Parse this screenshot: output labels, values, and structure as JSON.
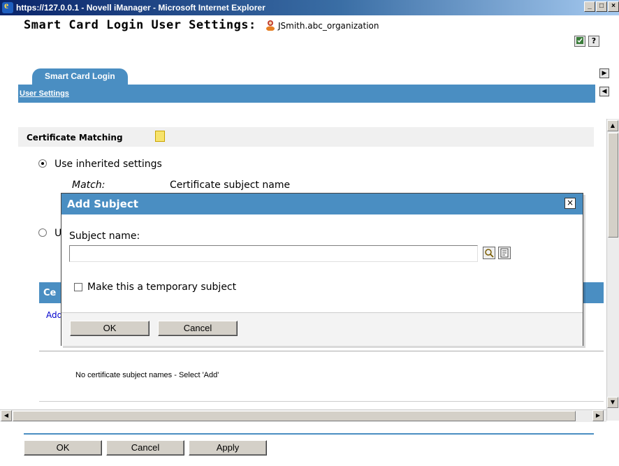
{
  "window": {
    "title": "https://127.0.0.1 - Novell iManager - Microsoft Internet Explorer",
    "minimize": "_",
    "maximize": "□",
    "close": "×"
  },
  "header": {
    "title": "Smart Card Login User Settings:",
    "user": "JSmith.abc_organization"
  },
  "tabs": {
    "active_tab": "Smart Card Login",
    "sub_link": "User Settings"
  },
  "section": {
    "title": "Certificate Matching",
    "option_inherited": "Use inherited settings",
    "option_user_peek": "U",
    "match_label": "Match:",
    "match_value": "Certificate subject name",
    "band_peek": "Ce",
    "add_peek": "Add",
    "empty_message": "No certificate subject names - Select 'Add'"
  },
  "dialog": {
    "title": "Add Subject",
    "close": "×",
    "subject_label": "Subject name:",
    "subject_value": "",
    "temporary_label": "Make this a temporary subject",
    "ok": "OK",
    "cancel": "Cancel"
  },
  "footer": {
    "ok": "OK",
    "cancel": "Cancel",
    "apply": "Apply"
  },
  "colors": {
    "accent": "#4a8ec2",
    "titlebar": "#0a246a"
  }
}
